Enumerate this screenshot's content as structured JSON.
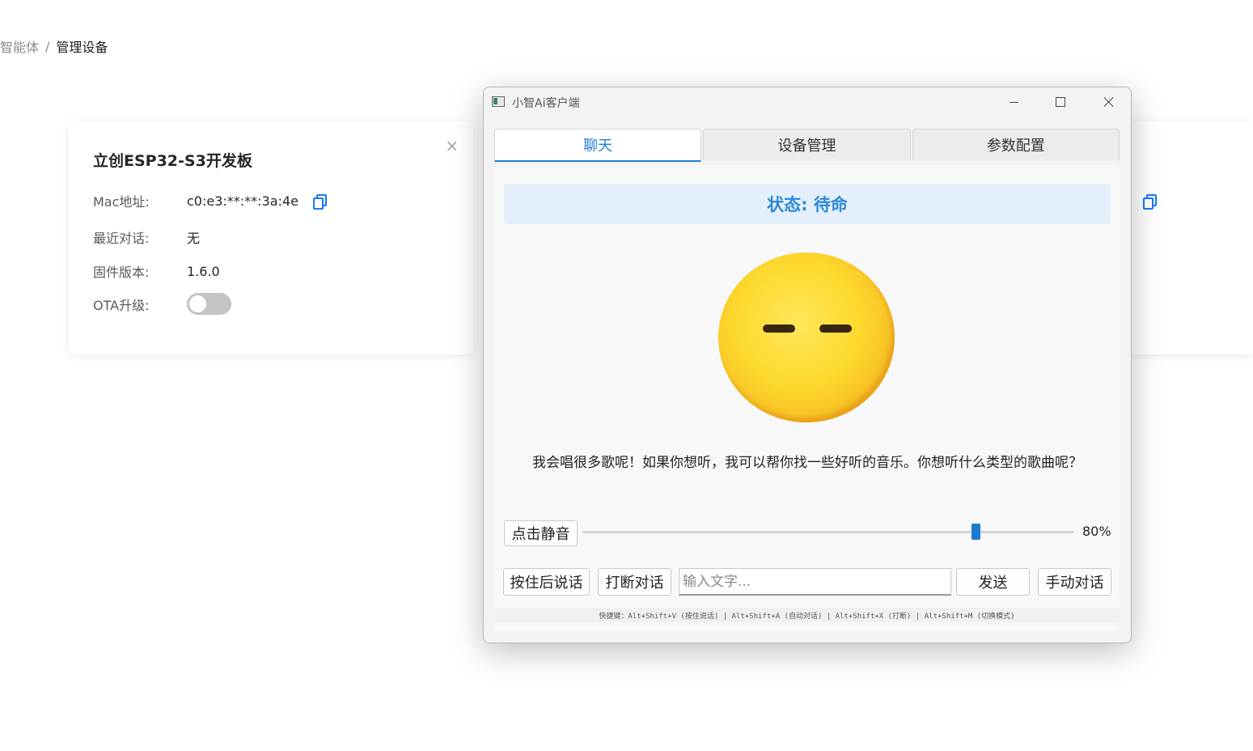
{
  "breadcrumb": {
    "parent": "智能体",
    "separator": "/",
    "current": "管理设备"
  },
  "device_card": {
    "title": "立创ESP32-S3开发板",
    "close_glyph": "×",
    "mac_label": "Mac地址:",
    "mac_value": "c0:e3:**:**:3a:4e",
    "last_chat_label": "最近对话:",
    "last_chat_value": "无",
    "firmware_label": "固件版本:",
    "firmware_value": "1.6.0",
    "ota_label": "OTA升级:",
    "ota_enabled": false
  },
  "window": {
    "title": "小智Ai客户端",
    "tabs": [
      {
        "label": "聊天",
        "active": true
      },
      {
        "label": "设备管理",
        "active": false
      },
      {
        "label": "参数配置",
        "active": false
      }
    ],
    "status": "状态: 待命",
    "emoji": "neutral-face",
    "message": "我会唱很多歌呢！如果你想听，我可以帮你找一些好听的音乐。你想听什么类型的歌曲呢？",
    "mute_button": "点击静音",
    "volume_percent": 80,
    "volume_label": "80%",
    "push_to_talk_button": "按住后说话",
    "interrupt_button": "打断对话",
    "input_placeholder": "输入文字...",
    "input_value": "",
    "send_button": "发送",
    "manual_mode_button": "手动对话",
    "shortcuts": "快捷键：Alt+Shift+V (按住说话) | Alt+Shift+A (自动对话) | Alt+Shift+X (打断) | Alt+Shift+M (切换模式)"
  },
  "colors": {
    "accent": "#1f7fd4",
    "status_bg": "#e3f0fb",
    "status_text": "#2e8ad8",
    "toggle_off": "#c4c4c4"
  }
}
